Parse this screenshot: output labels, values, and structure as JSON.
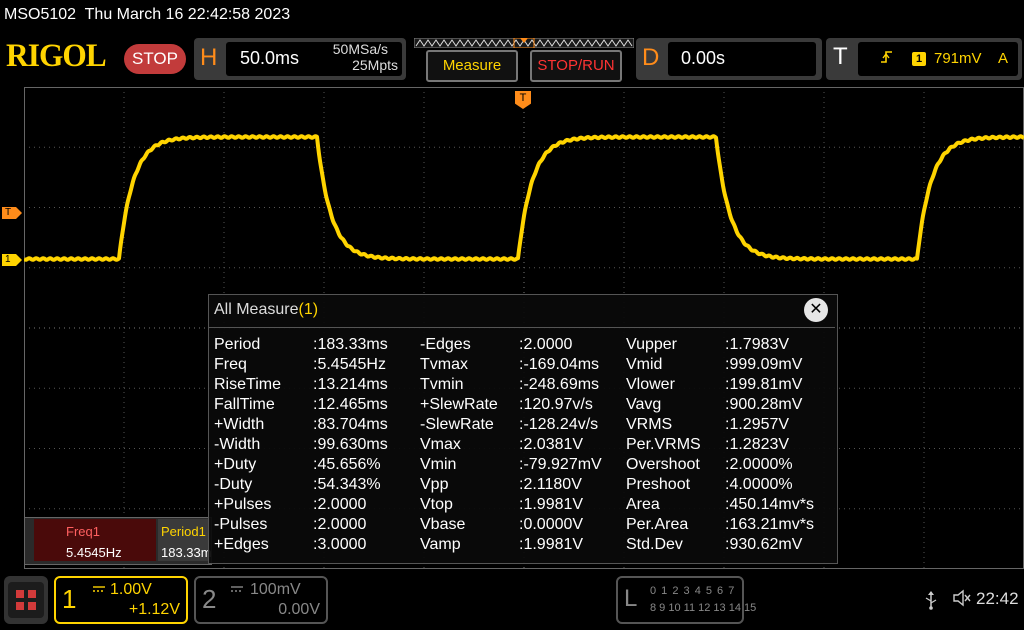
{
  "title": "MSO5102  Thu March 16 22:42:58 2023",
  "logo": "RIGOL",
  "run_state": "STOP",
  "horizontal": {
    "letter": "H",
    "timebase": "50.0ms",
    "sample_rate": "50MSa/s",
    "memory_depth": "25Mpts"
  },
  "buttons": {
    "measure": "Measure",
    "stop_run": "STOP/RUN"
  },
  "delay": {
    "letter": "D",
    "value": "0.00s"
  },
  "trigger": {
    "letter": "T",
    "source": "1",
    "level": "791mV",
    "mode": "A",
    "edge_icon": "rising-edge-icon"
  },
  "markers": {
    "trigger_level": "T",
    "channel1": "1",
    "trigger_pos": "T"
  },
  "measure_window": {
    "title": "All Measure",
    "count": "(1)",
    "close": "✕",
    "rows": [
      [
        [
          "Period",
          ":183.33ms"
        ],
        [
          "-Edges",
          ":2.0000"
        ],
        [
          "Vupper",
          ":1.7983V"
        ]
      ],
      [
        [
          "Freq",
          ":5.4545Hz"
        ],
        [
          "Tvmax",
          ":-169.04ms"
        ],
        [
          "Vmid",
          ":999.09mV"
        ]
      ],
      [
        [
          "RiseTime",
          ":13.214ms"
        ],
        [
          "Tvmin",
          ":-248.69ms"
        ],
        [
          "Vlower",
          ":199.81mV"
        ]
      ],
      [
        [
          "FallTime",
          ":12.465ms"
        ],
        [
          "+SlewRate",
          ":120.97v/s"
        ],
        [
          "Vavg",
          ":900.28mV"
        ]
      ],
      [
        [
          "+Width",
          ":83.704ms"
        ],
        [
          "-SlewRate",
          ":-128.24v/s"
        ],
        [
          "VRMS",
          ":1.2957V"
        ]
      ],
      [
        [
          "-Width",
          ":99.630ms"
        ],
        [
          "Vmax",
          ":2.0381V"
        ],
        [
          "Per.VRMS",
          ":1.2823V"
        ]
      ],
      [
        [
          "+Duty",
          ":45.656%"
        ],
        [
          "Vmin",
          ":-79.927mV"
        ],
        [
          "Overshoot",
          ":2.0000%"
        ]
      ],
      [
        [
          "-Duty",
          ":54.343%"
        ],
        [
          "Vpp",
          ":2.1180V"
        ],
        [
          "Preshoot",
          ":4.0000%"
        ]
      ],
      [
        [
          "+Pulses",
          ":2.0000"
        ],
        [
          "Vtop",
          ":1.9981V"
        ],
        [
          "Area",
          ":450.14mv*s"
        ]
      ],
      [
        [
          "-Pulses",
          ":2.0000"
        ],
        [
          "Vbase",
          ":0.0000V"
        ],
        [
          "Per.Area",
          ":163.21mv*s"
        ]
      ],
      [
        [
          "+Edges",
          ":3.0000"
        ],
        [
          "Vamp",
          ":1.9981V"
        ],
        [
          "Std.Dev",
          ":930.62mV"
        ]
      ]
    ]
  },
  "results": [
    {
      "name": "Freq1",
      "value": "5.4545Hz"
    },
    {
      "name": "Period1",
      "value": "183.33m"
    }
  ],
  "ch1": {
    "num": "1",
    "scale": "1.00V",
    "offset": "+1.12V",
    "color": "#ffd400"
  },
  "ch2": {
    "num": "2",
    "scale": "100mV",
    "offset": "0.00V",
    "color": "#888888"
  },
  "la": {
    "letter": "L",
    "row1": "0 1 2 3  4 5 6 7",
    "row2": "8 9 10 11 12 13 14 15"
  },
  "status": {
    "clock": "22:42",
    "usb_icon": "usb-icon",
    "speaker_icon": "speaker-muted-icon"
  },
  "colors": {
    "trace": "#ffd400",
    "accent": "#ff8c1a",
    "stop": "#c23b3b"
  }
}
